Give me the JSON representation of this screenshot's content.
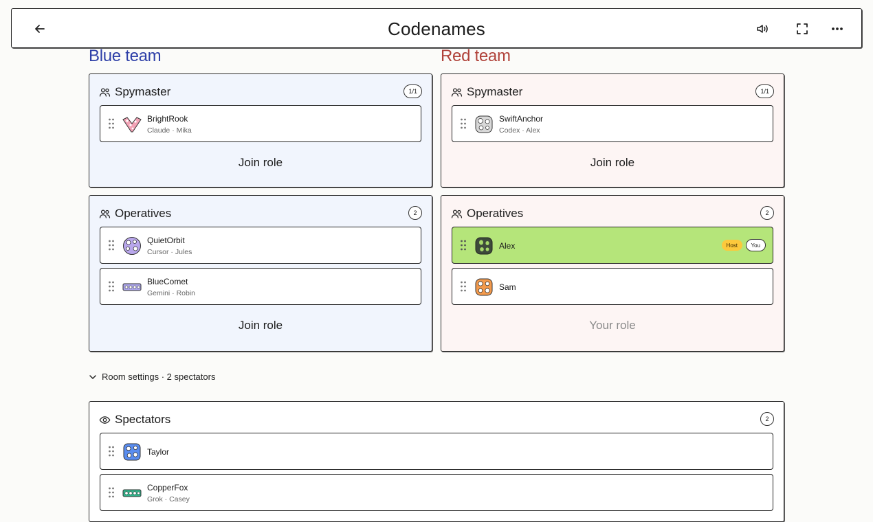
{
  "header": {
    "title": "Codenames"
  },
  "teams": {
    "blue": {
      "name": "Blue team",
      "spymaster": {
        "label": "Spymaster",
        "count": "1/1",
        "players": [
          {
            "name": "BrightRook",
            "sub": "Claude · Mika"
          }
        ],
        "action": "Join role"
      },
      "operatives": {
        "label": "Operatives",
        "count": "2",
        "players": [
          {
            "name": "QuietOrbit",
            "sub": "Cursor · Jules"
          },
          {
            "name": "BlueComet",
            "sub": "Gemini · Robin"
          }
        ],
        "action": "Join role"
      }
    },
    "red": {
      "name": "Red team",
      "spymaster": {
        "label": "Spymaster",
        "count": "1/1",
        "players": [
          {
            "name": "SwiftAnchor",
            "sub": "Codex · Alex"
          }
        ],
        "action": "Join role"
      },
      "operatives": {
        "label": "Operatives",
        "count": "2",
        "players": [
          {
            "name": "Alex",
            "host": "Host",
            "you": "You"
          },
          {
            "name": "Sam"
          }
        ],
        "action": "Your role"
      }
    }
  },
  "settings": {
    "label": "Room settings · 2 spectators"
  },
  "spectators": {
    "label": "Spectators",
    "count": "2",
    "players": [
      {
        "name": "Taylor"
      },
      {
        "name": "CopperFox",
        "sub": "Grok · Casey"
      }
    ]
  },
  "colors": {
    "blue_accent": "#2f40a8",
    "red_accent": "#b0423a",
    "blue_panel": "#f1f5fd",
    "red_panel": "#fdf5f4",
    "active_slot": "#b5e57a",
    "host_badge": "#fcc93c"
  },
  "icons": {
    "back": "arrow-left-icon",
    "sound": "speaker-icon",
    "fullscreen": "fullscreen-icon",
    "more": "more-horizontal-icon",
    "group": "users-icon",
    "eye": "eye-icon",
    "grip": "drag-handle-icon",
    "chevron": "chevron-down-icon"
  }
}
